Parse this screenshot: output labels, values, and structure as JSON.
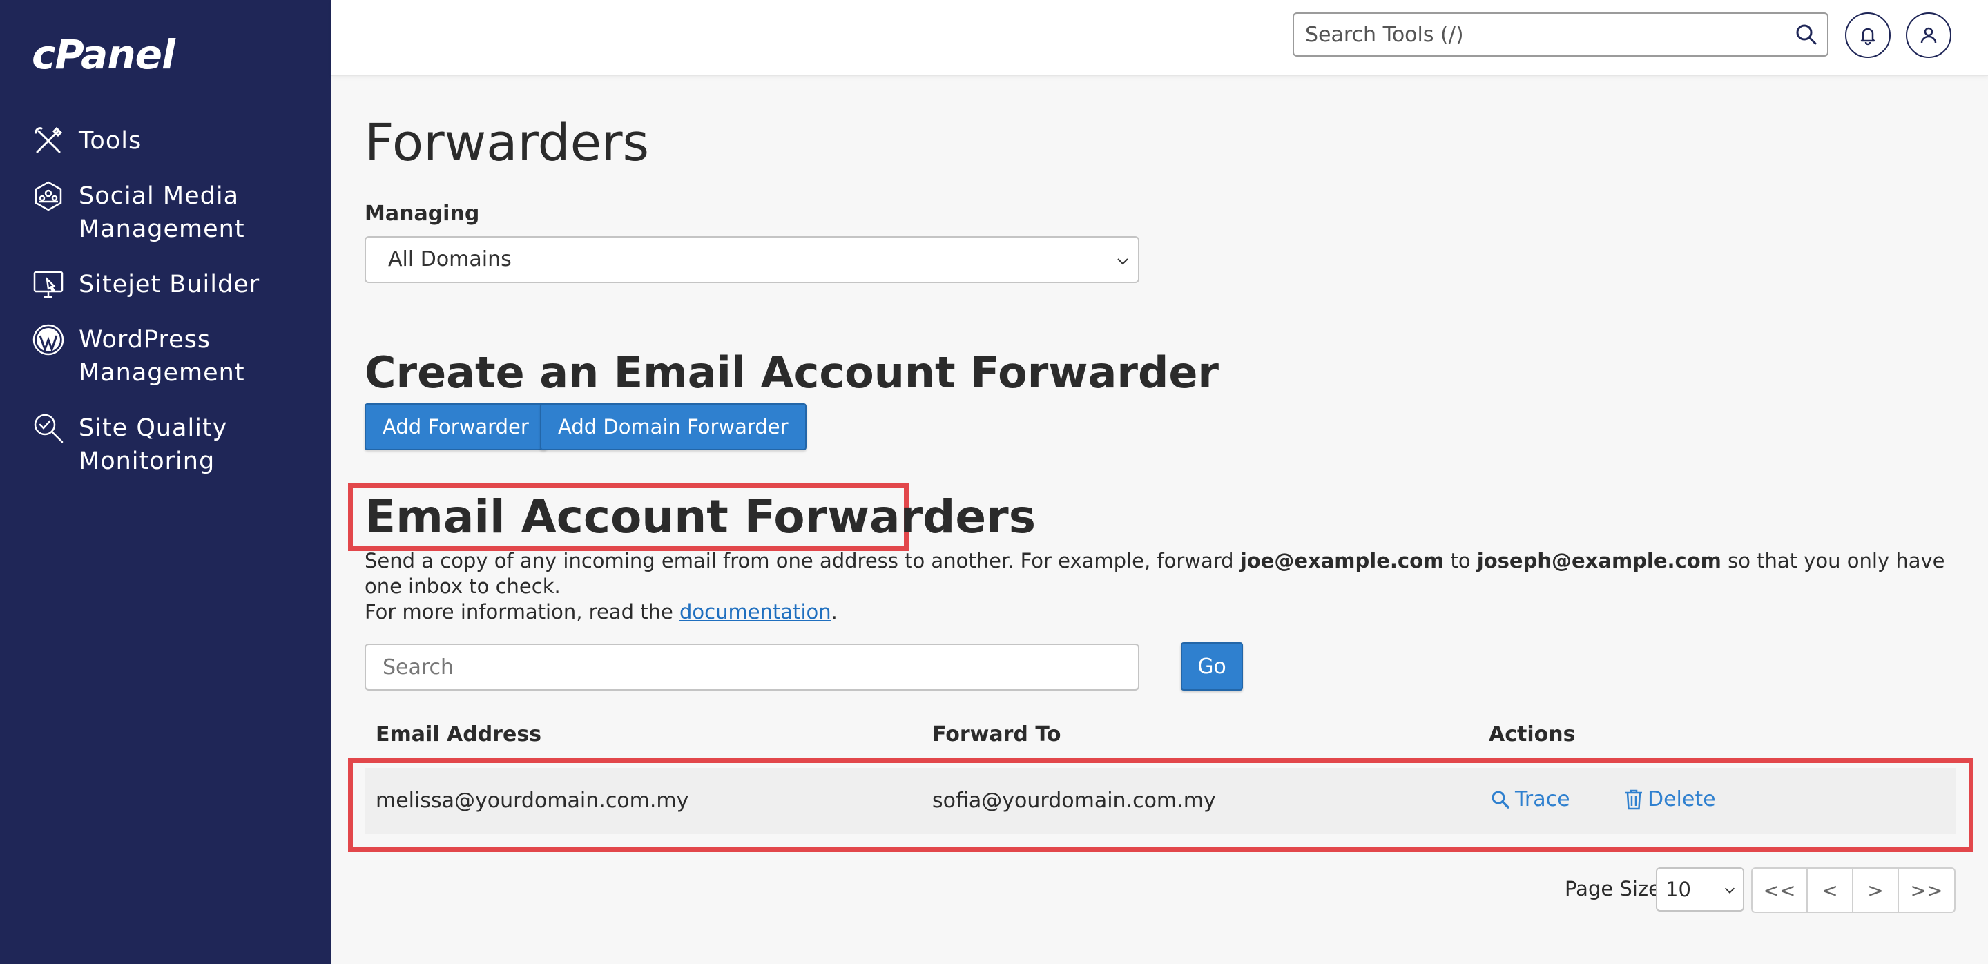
{
  "app": {
    "logo": "cPanel"
  },
  "sidebar": {
    "items": [
      {
        "label": "Tools",
        "icon": "tools-icon"
      },
      {
        "label": "Social Media\nManagement",
        "icon": "social-media-icon"
      },
      {
        "label": "Sitejet Builder",
        "icon": "sitejet-icon"
      },
      {
        "label": "WordPress\nManagement",
        "icon": "wordpress-icon"
      },
      {
        "label": "Site Quality\nMonitoring",
        "icon": "site-quality-icon"
      }
    ]
  },
  "topbar": {
    "search_placeholder": "Search Tools (/)"
  },
  "page": {
    "title": "Forwarders",
    "managing_label": "Managing",
    "managing_value": "All Domains",
    "create_heading": "Create an Email Account Forwarder",
    "add_forwarder": "Add Forwarder",
    "add_domain_forwarder": "Add Domain Forwarder",
    "forwarders_heading": "Email Account Forwarders",
    "desc_part1": "Send a copy of any incoming email from one address to another. For example, forward ",
    "desc_email1": "joe@example.com",
    "desc_part2": " to ",
    "desc_email2": "joseph@example.com",
    "desc_part3": " so that you only have one inbox to check.",
    "desc_part4": "For more information, read the ",
    "desc_link": "documentation",
    "desc_part5": ".",
    "search_placeholder": "Search",
    "go_label": "Go"
  },
  "table": {
    "headers": [
      "Email Address",
      "Forward To",
      "Actions"
    ],
    "rows": [
      {
        "email": "melissa@yourdomain.com.my",
        "forward_to": "sofia@yourdomain.com.my",
        "trace": "Trace",
        "delete": "Delete"
      }
    ]
  },
  "pagination": {
    "page_size_label": "Page Size",
    "page_size_value": "10",
    "first": "<<",
    "prev": "<",
    "next": ">",
    "last": ">>"
  },
  "colors": {
    "sidebar_bg": "#1f2657",
    "primary": "#2f80cf",
    "highlight": "#e2474b"
  }
}
